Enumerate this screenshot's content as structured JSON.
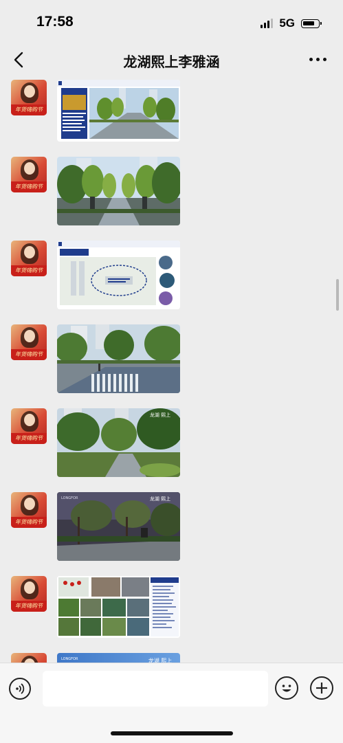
{
  "status": {
    "time": "17:58",
    "network": "5G",
    "battery_level": 0.8
  },
  "header": {
    "title": "龙湖熙上李雅涵",
    "back_icon": "chevron-left-icon",
    "more_icon": "ellipsis-icon"
  },
  "avatar": {
    "banner_text": "年货嗨购节"
  },
  "messages": [
    {
      "type": "image",
      "kind": "slide-gardens",
      "heading": "景观规划亮点空间（秀影轴）",
      "tag": "林影 · 夏木成荫"
    },
    {
      "type": "image",
      "kind": "photo-boulevard"
    },
    {
      "type": "image",
      "kind": "slide-plan",
      "heading": "景观规划亮点空间（全龄空间）",
      "tag": "500m风景跑道",
      "note": "500M 慢跑跑道 KEEP：运动汇"
    },
    {
      "type": "image",
      "kind": "photo-plaza"
    },
    {
      "type": "image",
      "kind": "photo-garden",
      "watermark": "龙湖 熙上"
    },
    {
      "type": "image",
      "kind": "photo-courtyard",
      "watermark": "龙湖 熙上",
      "logo": "LONGFOR"
    },
    {
      "type": "image",
      "kind": "slide-collage",
      "heading": "产品规划"
    },
    {
      "type": "image",
      "kind": "slide-banner",
      "watermark": "龙湖 熙上",
      "logo": "LONGFOR"
    }
  ],
  "input": {
    "voice_icon": "voice-icon",
    "emoji_icon": "emoji-icon",
    "plus_icon": "plus-icon",
    "placeholder": ""
  },
  "colors": {
    "background": "#ededed",
    "slide_blue": "#1f3c8c",
    "accent_red": "#c8201a"
  }
}
